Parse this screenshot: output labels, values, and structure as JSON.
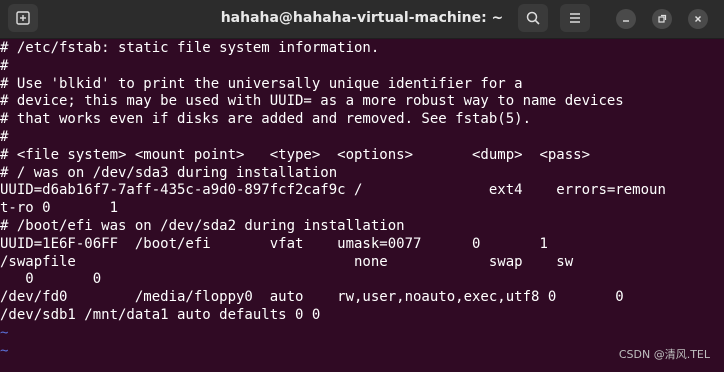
{
  "window": {
    "title": "hahaha@hahaha-virtual-machine: ~",
    "icons": {
      "new_tab": "new-tab-icon",
      "search": "search-icon",
      "menu": "hamburger-menu-icon",
      "minimize": "minimize-icon",
      "maximize": "maximize-icon",
      "close": "close-icon"
    }
  },
  "terminal": {
    "lines": [
      "# /etc/fstab: static file system information.",
      "#",
      "# Use 'blkid' to print the universally unique identifier for a",
      "# device; this may be used with UUID= as a more robust way to name devices",
      "# that works even if disks are added and removed. See fstab(5).",
      "#",
      "# <file system> <mount point>   <type>  <options>       <dump>  <pass>",
      "# / was on /dev/sda3 during installation",
      "UUID=d6ab16f7-7aff-435c-a9d0-897fcf2caf9c /               ext4    errors=remoun",
      "t-ro 0       1",
      "# /boot/efi was on /dev/sda2 during installation",
      "UUID=1E6F-06FF  /boot/efi       vfat    umask=0077      0       1",
      "/swapfile                                 none            swap    sw",
      "   0       0",
      "/dev/fd0        /media/floppy0  auto    rw,user,noauto,exec,utf8 0       0",
      "/dev/sdb1 /mnt/data1 auto defaults 0 0"
    ],
    "tildes": [
      "~",
      "~"
    ]
  },
  "watermark": "CSDN @清风.TEL",
  "colors": {
    "background": "#300a24",
    "titlebar": "#2c2c2c",
    "text": "#ffffff",
    "tilde": "#5a6fd6"
  }
}
